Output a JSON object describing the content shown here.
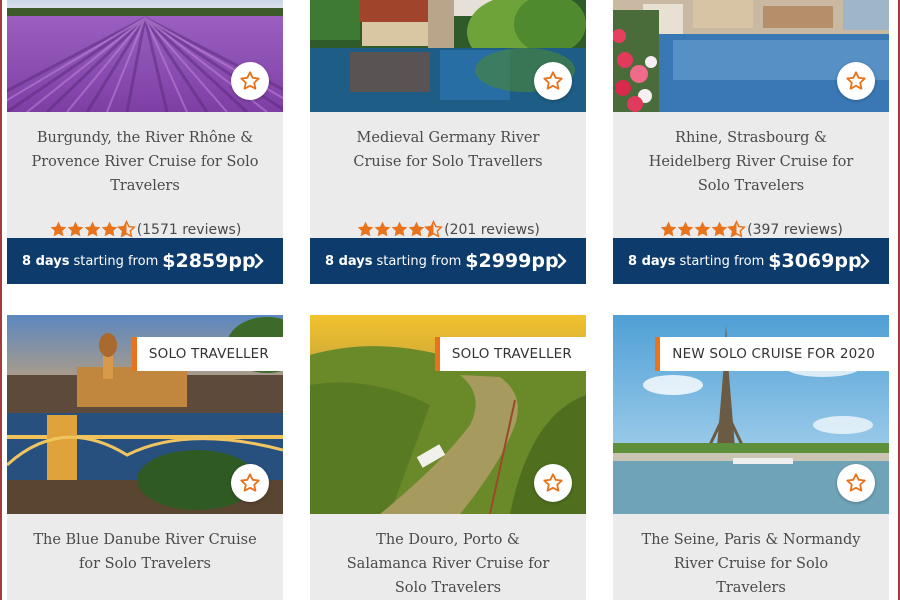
{
  "accent_color": "#e8731c",
  "price_bar_color": "#0d3b6b",
  "cards_top": [
    {
      "title": "Burgundy, the River Rhône & Provence River Cruise for Solo Travelers",
      "rating": 4.5,
      "reviews": "(1571 reviews)",
      "days": "8 days",
      "from_label": "starting from",
      "price": "$2859pp",
      "favorite_icon": "star-outline-icon"
    },
    {
      "title": "Medieval Germany River Cruise for Solo Travellers",
      "rating": 4.5,
      "reviews": "(201 reviews)",
      "days": "8 days",
      "from_label": "starting from",
      "price": "$2999pp",
      "favorite_icon": "star-outline-icon"
    },
    {
      "title": "Rhine, Strasbourg & Heidelberg River Cruise for Solo Travelers",
      "rating": 4.5,
      "reviews": "(397 reviews)",
      "days": "8 days",
      "from_label": "starting from",
      "price": "$3069pp",
      "favorite_icon": "star-outline-icon"
    }
  ],
  "cards_bottom": [
    {
      "badge": "SOLO TRAVELLER",
      "title": "The Blue Danube River Cruise for Solo Travelers",
      "favorite_icon": "star-outline-icon"
    },
    {
      "badge": "SOLO TRAVELLER",
      "title": "The Douro, Porto & Salamanca River Cruise for Solo Travelers",
      "favorite_icon": "star-outline-icon"
    },
    {
      "badge": "NEW SOLO CRUISE FOR 2020",
      "title": "The Seine, Paris & Normandy River Cruise for Solo Travelers",
      "favorite_icon": "star-outline-icon"
    }
  ]
}
